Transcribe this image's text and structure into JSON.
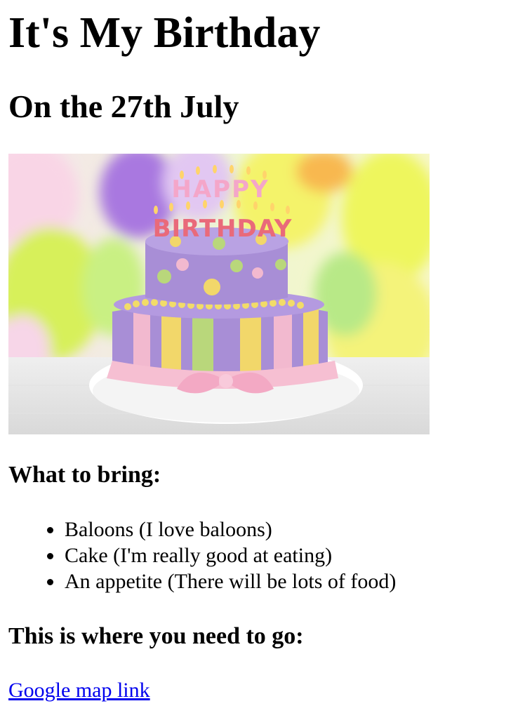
{
  "page": {
    "title": "It's My Birthday",
    "subtitle": "On the 27th July"
  },
  "image": {
    "icon": "birthday-cake-icon",
    "candle_text_top": "HAPPY",
    "candle_text_bottom": "BIRTHDAY",
    "colors": {
      "cake_purple": "#a88ed6",
      "stripe_yellow": "#f2d76a",
      "stripe_green": "#b9d77b",
      "stripe_pink": "#f2b9cf",
      "ribbon_pink": "#f6bfd2"
    }
  },
  "bring": {
    "heading": "What to bring:",
    "items": [
      "Baloons (I love baloons)",
      "Cake (I'm really good at eating)",
      "An appetite (There will be lots of food)"
    ]
  },
  "location": {
    "heading": "This is where you need to go:",
    "link_text": "Google map link"
  },
  "colors": {
    "link": "#0000ee",
    "text": "#000000"
  }
}
